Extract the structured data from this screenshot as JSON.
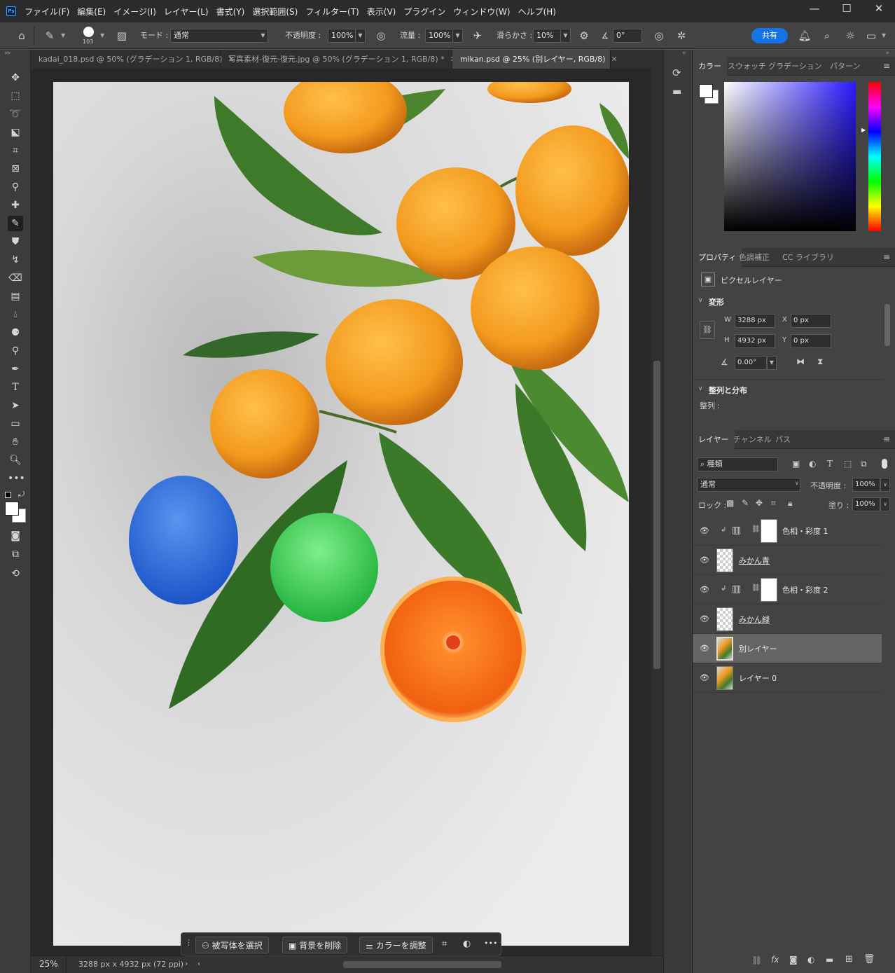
{
  "menubar": {
    "app_badge": "Ps",
    "items": [
      "ファイル(F)",
      "編集(E)",
      "イメージ(I)",
      "レイヤー(L)",
      "書式(Y)",
      "選択範囲(S)",
      "フィルター(T)",
      "表示(V)",
      "プラグイン",
      "ウィンドウ(W)",
      "ヘルプ(H)"
    ],
    "minimize": "—",
    "maximize": "☐",
    "close": "✕"
  },
  "options": {
    "brush_size": "103",
    "mode_label": "モード :",
    "mode_value": "通常",
    "opacity_label": "不透明度 :",
    "opacity_value": "100%",
    "flow_label": "流量 :",
    "flow_value": "100%",
    "smoothing_label": "滑らかさ :",
    "smoothing_value": "10%",
    "angle_value": "0°",
    "share_label": "共有"
  },
  "tabs": [
    {
      "label": "kadai_018.psd @ 50% (グラデーション 1, RGB/8)",
      "close": "✕"
    },
    {
      "label": "写真素材-復元-復元.jpg @ 50% (グラデーション 1, RGB/8) *",
      "close": "✕"
    },
    {
      "label": "mikan.psd @ 25% (別レイヤー, RGB/8)",
      "close": "✕"
    }
  ],
  "context_bar": {
    "select_subject": "被写体を選択",
    "remove_bg": "背景を削除",
    "adjust_color": "カラーを調整",
    "more": "•••"
  },
  "status": {
    "zoom": "25%",
    "doc_info": "3288 px x 4932 px (72 ppi)"
  },
  "color_panel": {
    "tabs": [
      "カラー",
      "スウォッチ",
      "グラデーション",
      "パターン"
    ]
  },
  "properties_panel": {
    "tabs": [
      "プロパティ",
      "色調補正",
      "CC ライブラリ"
    ],
    "layer_type": "ピクセルレイヤー",
    "transform_label": "変形",
    "w_label": "W",
    "w_value": "3288 px",
    "h_label": "H",
    "h_value": "4932 px",
    "x_label": "X",
    "x_value": "0 px",
    "y_label": "Y",
    "y_value": "0 px",
    "angle_value": "0.00°",
    "align_label": "整列と分布",
    "align_sub": "整列 :"
  },
  "layers_panel": {
    "tabs": [
      "レイヤー",
      "チャンネル",
      "パス"
    ],
    "filter_kind": "種類",
    "blend_mode": "通常",
    "opacity_label": "不透明度 :",
    "opacity_value": "100%",
    "lock_label": "ロック :",
    "fill_label": "塗り :",
    "fill_value": "100%",
    "layers": [
      {
        "name": "色相・彩度 1",
        "type": "adjustment"
      },
      {
        "name": "みかん青",
        "type": "pixel"
      },
      {
        "name": "色相・彩度 2",
        "type": "adjustment"
      },
      {
        "name": "みかん緑",
        "type": "pixel"
      },
      {
        "name": "別レイヤー",
        "type": "photo",
        "selected": true
      },
      {
        "name": "レイヤー 0",
        "type": "photo"
      }
    ]
  }
}
